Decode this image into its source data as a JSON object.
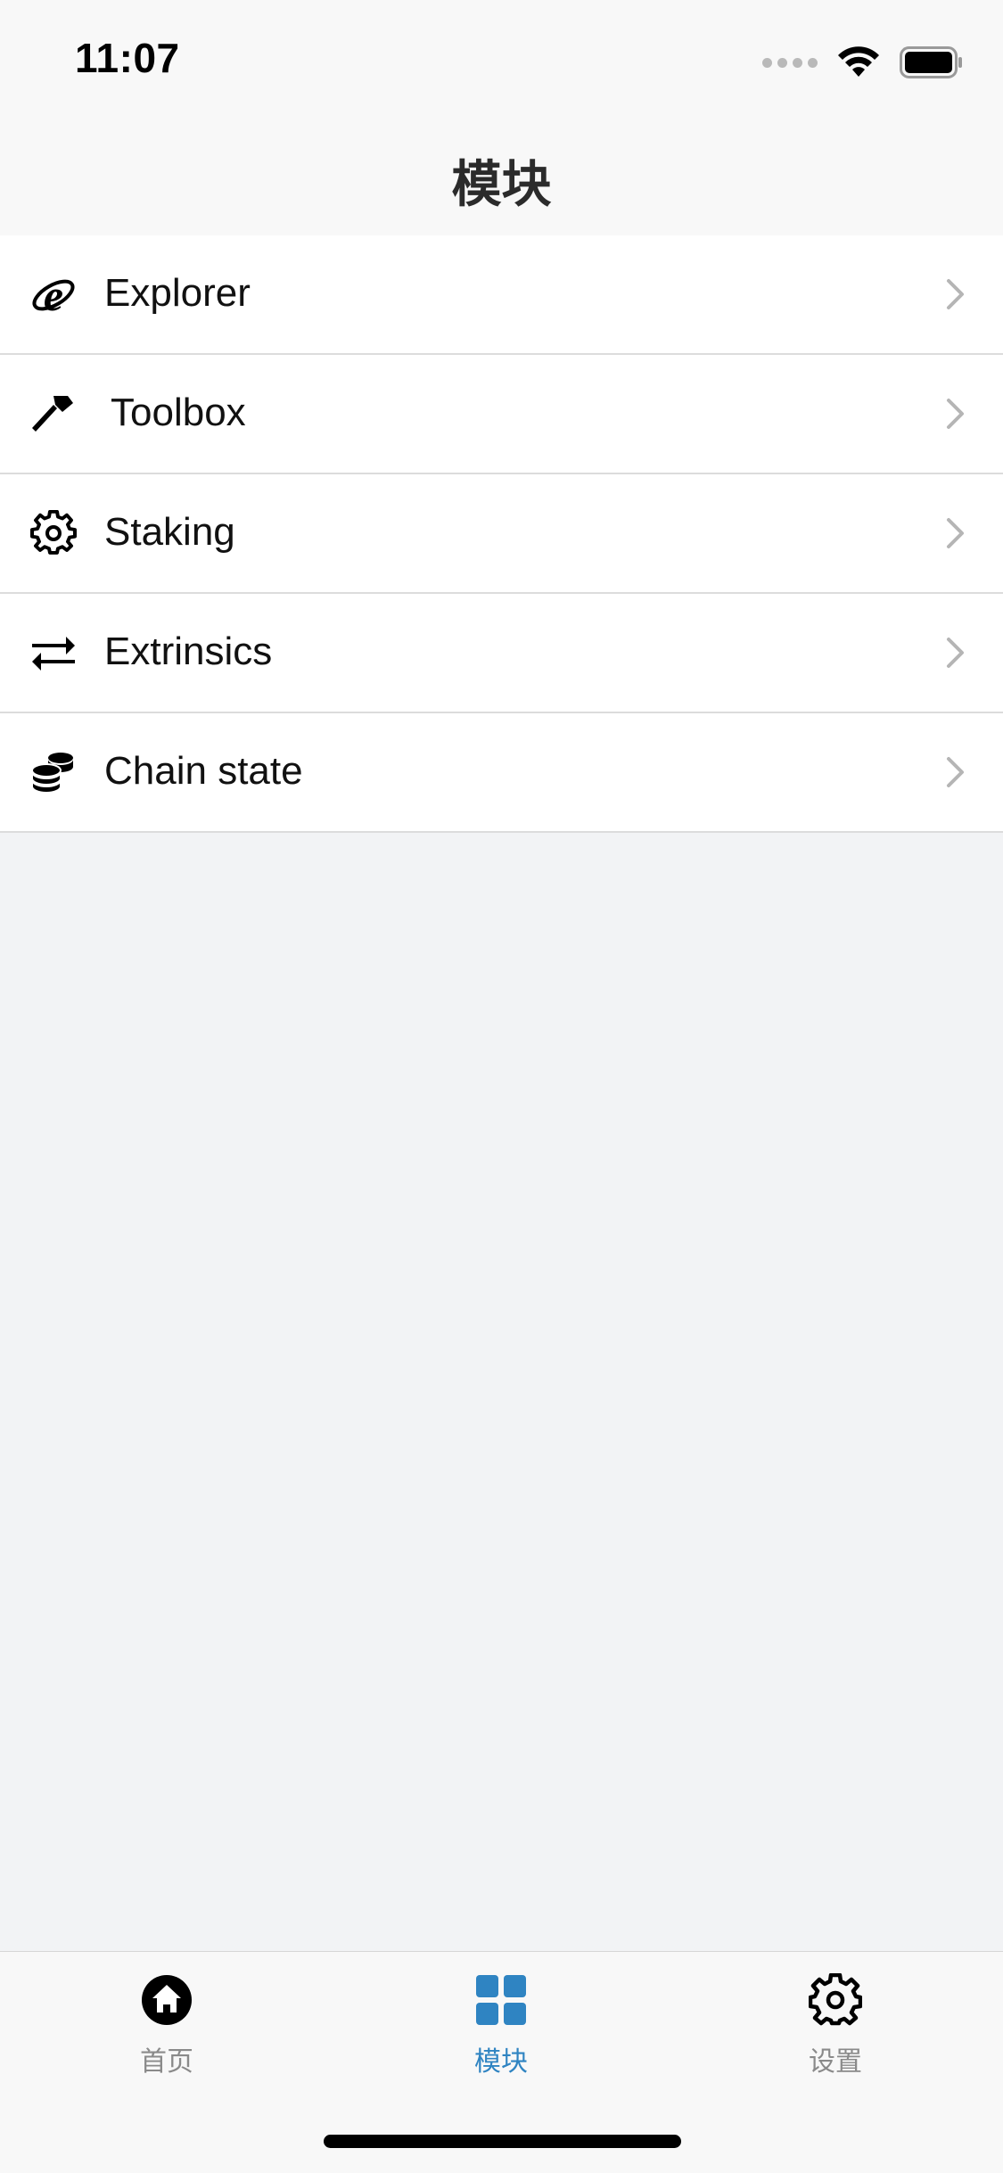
{
  "status_bar": {
    "time": "11:07",
    "icons": [
      "signal-dots-icon",
      "wifi-icon",
      "battery-icon"
    ]
  },
  "nav": {
    "title": "模块"
  },
  "list": {
    "items": [
      {
        "label": "Explorer",
        "icon": "explorer-icon"
      },
      {
        "label": "Toolbox",
        "icon": "hammer-icon"
      },
      {
        "label": "Staking",
        "icon": "gear-icon"
      },
      {
        "label": "Extrinsics",
        "icon": "exchange-arrows-icon"
      },
      {
        "label": "Chain state",
        "icon": "coins-stack-icon"
      }
    ]
  },
  "tab_bar": {
    "tabs": [
      {
        "label": "首页",
        "icon": "home-icon",
        "active": false
      },
      {
        "label": "模块",
        "icon": "grid-icon",
        "active": true
      },
      {
        "label": "设置",
        "icon": "settings-icon",
        "active": false
      }
    ],
    "active_color": "#2f84c2",
    "inactive_color": "#8a8a8a"
  }
}
